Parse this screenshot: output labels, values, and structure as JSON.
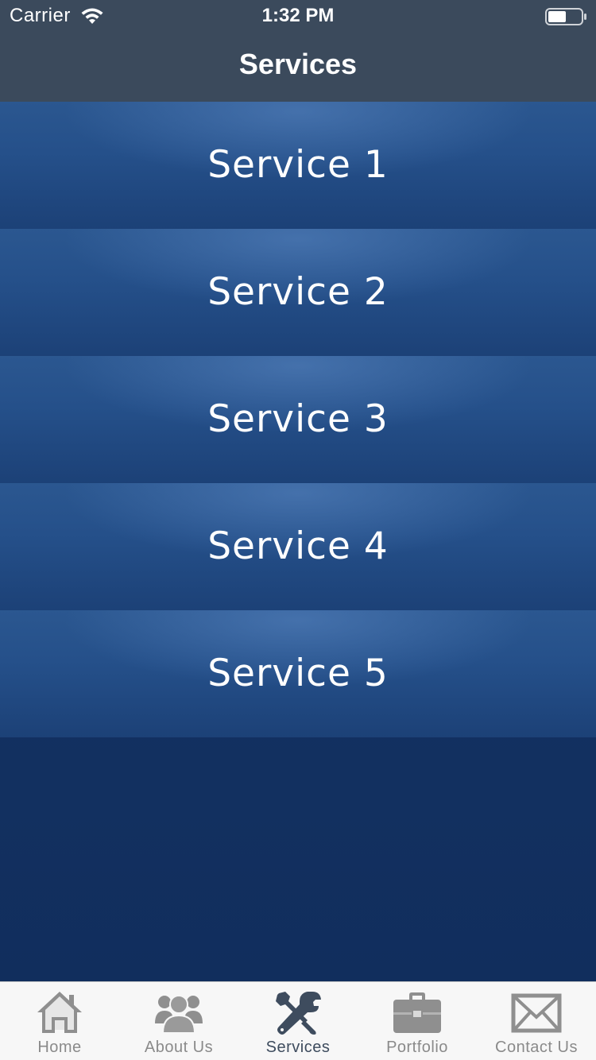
{
  "status_bar": {
    "carrier": "Carrier",
    "time": "1:32 PM",
    "wifi_icon": "wifi-icon",
    "battery_icon": "battery-icon"
  },
  "nav": {
    "title": "Services"
  },
  "services": [
    {
      "label": "Service 1"
    },
    {
      "label": "Service 2"
    },
    {
      "label": "Service 3"
    },
    {
      "label": "Service 4"
    },
    {
      "label": "Service 5"
    }
  ],
  "tab_bar": {
    "active_index": 2,
    "active_color": "#3e4c5e",
    "inactive_color": "#8a8a8a",
    "tabs": [
      {
        "label": "Home",
        "icon": "home-icon"
      },
      {
        "label": "About Us",
        "icon": "people-icon"
      },
      {
        "label": "Services",
        "icon": "tools-icon"
      },
      {
        "label": "Portfolio",
        "icon": "briefcase-icon"
      },
      {
        "label": "Contact Us",
        "icon": "envelope-icon"
      }
    ]
  },
  "colors": {
    "header_bg": "#3b4a5c",
    "row_bg": "#25508a",
    "content_bg": "#15345f",
    "tab_bar_bg": "#f7f7f7"
  }
}
